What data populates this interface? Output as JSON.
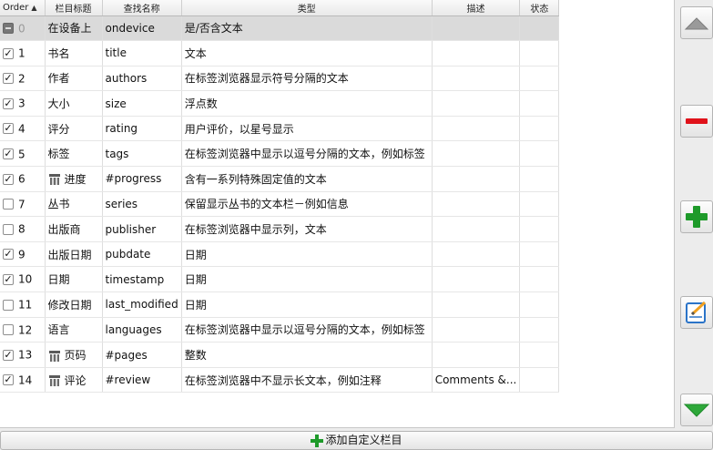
{
  "table": {
    "headers": {
      "order": "Order",
      "col_title": "栏目标题",
      "lookup": "查找名称",
      "type": "类型",
      "desc": "描述",
      "status": "状态"
    },
    "rows": [
      {
        "checked": "partial",
        "num": "0",
        "title": "在设备上",
        "lookup": "ondevice",
        "type": "是/否含文本",
        "desc": "",
        "custom": false
      },
      {
        "checked": "yes",
        "num": "1",
        "title": "书名",
        "lookup": "title",
        "type": "文本",
        "desc": "",
        "custom": false
      },
      {
        "checked": "yes",
        "num": "2",
        "title": "作者",
        "lookup": "authors",
        "type": "在标签浏览器显示符号分隔的文本",
        "desc": "",
        "custom": false
      },
      {
        "checked": "yes",
        "num": "3",
        "title": "大小",
        "lookup": "size",
        "type": "浮点数",
        "desc": "",
        "custom": false
      },
      {
        "checked": "yes",
        "num": "4",
        "title": "评分",
        "lookup": "rating",
        "type": "用户评价，以星号显示",
        "desc": "",
        "custom": false
      },
      {
        "checked": "yes",
        "num": "5",
        "title": "标签",
        "lookup": "tags",
        "type": "在标签浏览器中显示以逗号分隔的文本，例如标签",
        "desc": "",
        "custom": false
      },
      {
        "checked": "yes",
        "num": "6",
        "title": "进度",
        "lookup": "#progress",
        "type": "含有一系列特殊固定值的文本",
        "desc": "",
        "custom": true
      },
      {
        "checked": "no",
        "num": "7",
        "title": "丛书",
        "lookup": "series",
        "type": "保留显示丛书的文本栏－例如信息",
        "desc": "",
        "custom": false
      },
      {
        "checked": "no",
        "num": "8",
        "title": "出版商",
        "lookup": "publisher",
        "type": "在标签浏览器中显示列，文本",
        "desc": "",
        "custom": false
      },
      {
        "checked": "yes",
        "num": "9",
        "title": "出版日期",
        "lookup": "pubdate",
        "type": "日期",
        "desc": "",
        "custom": false
      },
      {
        "checked": "yes",
        "num": "10",
        "title": "日期",
        "lookup": "timestamp",
        "type": "日期",
        "desc": "",
        "custom": false
      },
      {
        "checked": "no",
        "num": "11",
        "title": "修改日期",
        "lookup": "last_modified",
        "type": "日期",
        "desc": "",
        "custom": false
      },
      {
        "checked": "no",
        "num": "12",
        "title": "语言",
        "lookup": "languages",
        "type": "在标签浏览器中显示以逗号分隔的文本，例如标签",
        "desc": "",
        "custom": false
      },
      {
        "checked": "yes",
        "num": "13",
        "title": "页码",
        "lookup": "#pages",
        "type": "整数",
        "desc": "",
        "custom": true
      },
      {
        "checked": "yes",
        "num": "14",
        "title": "评论",
        "lookup": "#review",
        "type": "在标签浏览器中不显示长文本，例如注释",
        "desc": "Comments &...",
        "custom": true
      }
    ]
  },
  "buttons": {
    "add_custom_label": "添加自定义栏目"
  },
  "icons": {
    "move_up": "triangle-up-icon",
    "remove": "minus-icon",
    "add": "plus-icon",
    "edit": "edit-icon",
    "move_down": "triangle-down-icon",
    "custom_column": "column-icon"
  },
  "colors": {
    "remove_red": "#e0121a",
    "add_green": "#1e9a2a",
    "down_green": "#2ea83a",
    "edit_blue": "#2b74c8"
  }
}
